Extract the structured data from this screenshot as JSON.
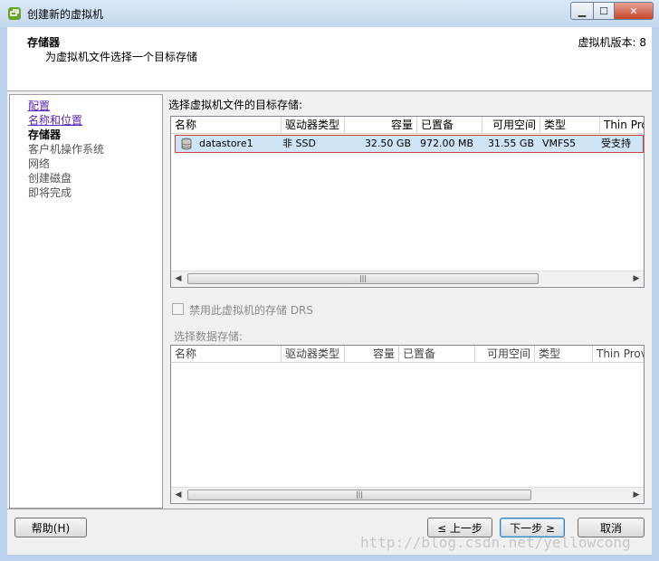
{
  "window": {
    "title": "创建新的虚拟机"
  },
  "header": {
    "title": "存储器",
    "subtitle": "为虚拟机文件选择一个目标存储",
    "version": "虚拟机版本: 8"
  },
  "steps": [
    {
      "label": "配置"
    },
    {
      "label": "名称和位置"
    },
    {
      "label": "存储器"
    },
    {
      "label": "客户机操作系统"
    },
    {
      "label": "网络"
    },
    {
      "label": "创建磁盘"
    },
    {
      "label": "即将完成"
    }
  ],
  "main": {
    "label": "选择虚拟机文件的目标存储:",
    "columns": [
      "名称",
      "驱动器类型",
      "容量",
      "已置备",
      "可用空间",
      "类型",
      "Thin Prov"
    ],
    "rows": [
      {
        "name": "datastore1",
        "drive_type": "非 SSD",
        "capacity": "32.50 GB",
        "provisioned": "972.00 MB",
        "free": "31.55 GB",
        "type": "VMFS5",
        "thin": "受支持"
      }
    ]
  },
  "drs": {
    "label": "禁用此虚拟机的存储 DRS"
  },
  "sub": {
    "label": "选择数据存储:",
    "columns": [
      "名称",
      "驱动器类型",
      "容量",
      "已置备",
      "可用空间",
      "类型",
      "Thin Provi"
    ]
  },
  "buttons": {
    "help": "帮助(H)",
    "back": "≤ 上一步",
    "next": "下一步 ≥",
    "cancel": "取消"
  },
  "watermark": "http://blog.csdn.net/yellowcong",
  "colors": {
    "accent": "#cde5f7",
    "link": "#5a28b4",
    "highlight_border": "#d04040"
  }
}
